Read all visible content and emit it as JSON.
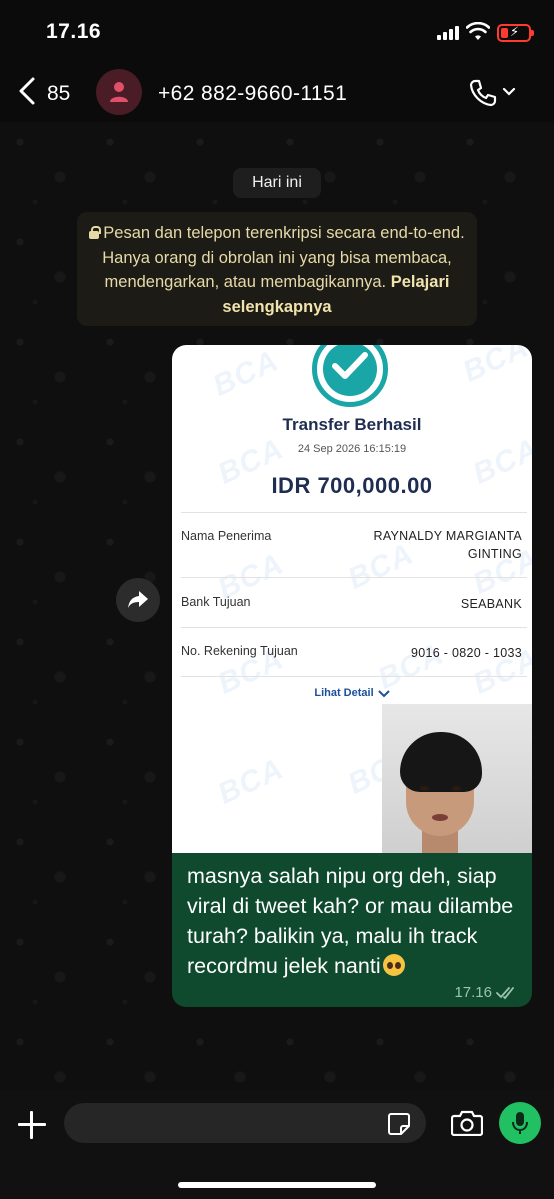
{
  "status_bar": {
    "time": "17.16"
  },
  "header": {
    "back_count": "85",
    "contact_name": "+62 882-9660-1151",
    "avatar_icon": "person-icon",
    "call_icon": "phone-icon"
  },
  "chat": {
    "date_label": "Hari ini",
    "encryption_notice": {
      "text": "Pesan dan telepon terenkripsi secara end-to-end. Hanya orang di obrolan ini yang bisa membaca, mendengarkan, atau membagikannya.",
      "link": "Pelajari selengkapnya"
    },
    "message": {
      "receipt": {
        "watermark": "BCA",
        "title": "Transfer Berhasil",
        "date": "24 Sep 2026 16:15:19",
        "amount": "IDR 700,000.00",
        "rows": [
          {
            "label": "Nama Penerima",
            "value_line1": "RAYNALDY MARGIANTA",
            "value_line2": "GINTING"
          },
          {
            "label": "Bank Tujuan",
            "value_line1": "SEABANK",
            "value_line2": ""
          },
          {
            "label": "No. Rekening Tujuan",
            "value_line1": "9016 - 0820 - 1033",
            "value_line2": ""
          }
        ],
        "detail_link": "Lihat Detail"
      },
      "text": "masnya salah nipu org deh, siap viral di tweet kah? or mau dilambe turah? balikin ya, malu ih track recordmu jelek nanti",
      "emoji": "pleading-face",
      "time": "17.16",
      "status": "read"
    }
  },
  "colors": {
    "bubble": "#0f4a2f",
    "accent_green": "#21c063",
    "notice_bg": "#1d1b16",
    "receipt_teal": "#1aa6a6",
    "receipt_navy": "#1f2d50"
  }
}
